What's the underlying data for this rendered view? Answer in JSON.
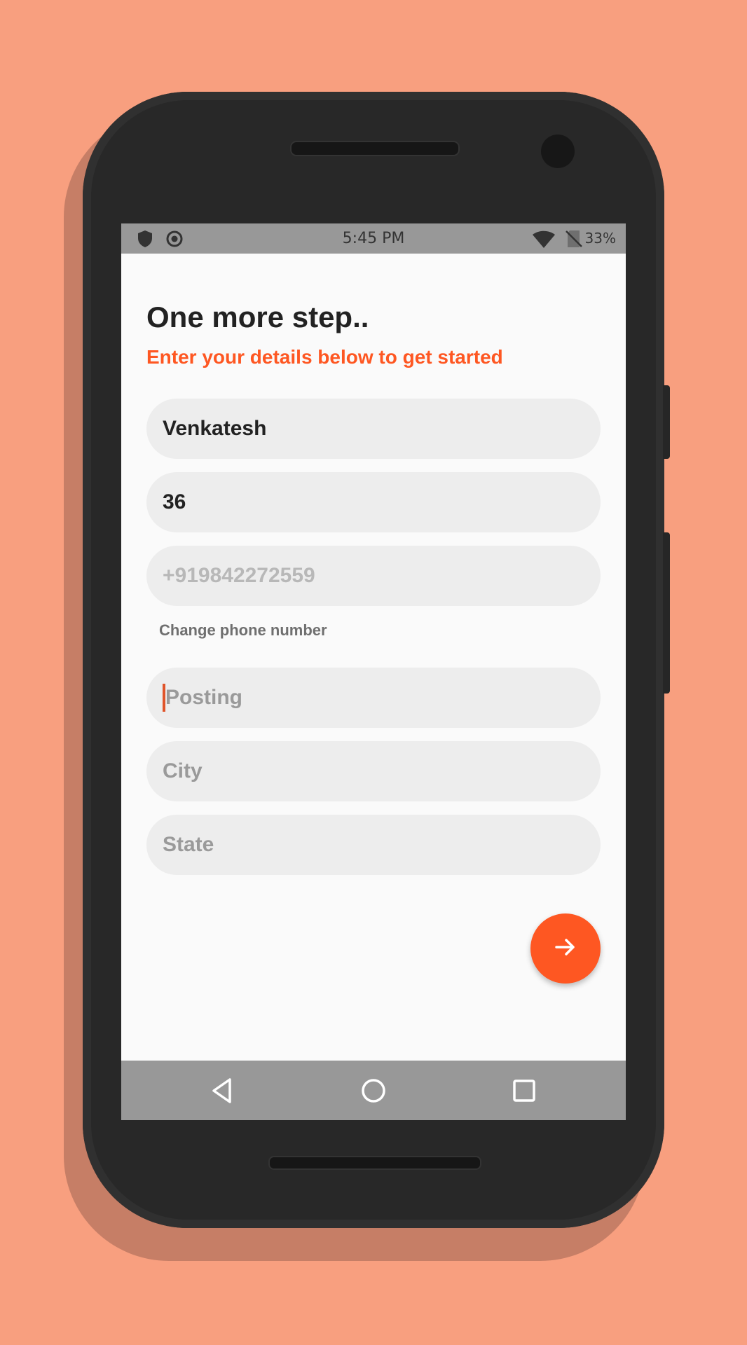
{
  "status_bar": {
    "time": "5:45 PM",
    "battery": "33%",
    "icons": [
      "shield-icon",
      "record-icon",
      "wifi-icon",
      "no-sim-icon"
    ]
  },
  "header": {
    "title": "One more step..",
    "subtitle": "Enter your details below to get started"
  },
  "form": {
    "name_value": "Venkatesh",
    "age_value": "36",
    "phone_value": "+919842272559",
    "change_phone_label": "Change phone number",
    "posting_placeholder": "Posting",
    "city_placeholder": "City",
    "state_placeholder": "State"
  },
  "fab": {
    "icon": "arrow-right-icon"
  },
  "nav_bar": {
    "icons": [
      "back-icon",
      "home-icon",
      "recents-icon"
    ]
  },
  "colors": {
    "background": "#f89f7f",
    "accent": "#fe5722",
    "phone_body": "#282828",
    "field_bg": "#ededed",
    "system_bar": "#989898"
  }
}
